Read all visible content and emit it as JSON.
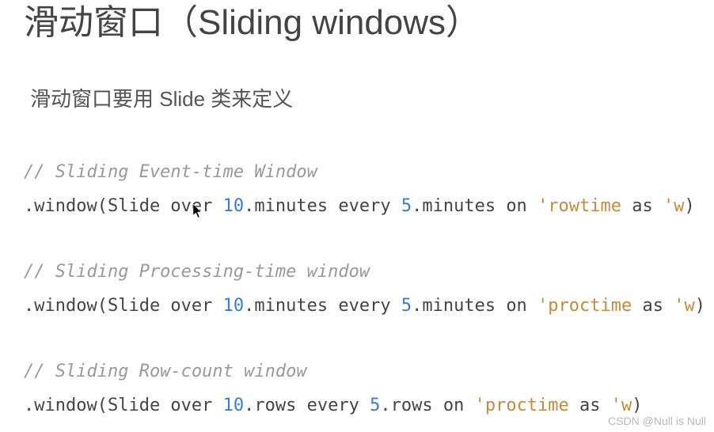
{
  "title": "滑动窗口（Sliding windows）",
  "subtitle": "滑动窗口要用 Slide 类来定义",
  "blocks": [
    {
      "comment": "// Sliding Event-time Window",
      "prefix": ".window(Slide over ",
      "n1": "10",
      "mid1": ".minutes every ",
      "n2": "5",
      "mid2": ".minutes on ",
      "s1": "'rowtime",
      "mid3": " as ",
      "s2": "'w",
      "suffix": ")"
    },
    {
      "comment": "// Sliding Processing-time window",
      "prefix": ".window(Slide over ",
      "n1": "10",
      "mid1": ".minutes every ",
      "n2": "5",
      "mid2": ".minutes on ",
      "s1": "'proctime",
      "mid3": " as ",
      "s2": "'w",
      "suffix": ")"
    },
    {
      "comment": "// Sliding Row-count window",
      "prefix": ".window(Slide over ",
      "n1": "10",
      "mid1": ".rows every ",
      "n2": "5",
      "mid2": ".rows on ",
      "s1": "'proctime",
      "mid3": " as ",
      "s2": "'w",
      "suffix": ")"
    }
  ],
  "watermark": "CSDN @Null is Null"
}
